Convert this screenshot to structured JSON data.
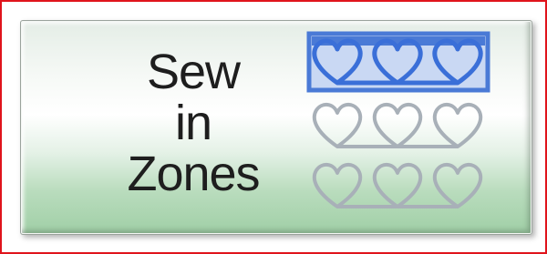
{
  "button": {
    "label_lines": [
      "Sew",
      "in",
      "Zones"
    ]
  },
  "icon": {
    "name": "heart-zones-icon",
    "rows": 3,
    "hearts_per_row": 3,
    "selected_row": 1
  },
  "colors": {
    "frame_border": "#e0141c",
    "selected_heart": "#3a6fd8",
    "selected_zone_border": "#4a7ad6",
    "selected_zone_fill": "#c9d8f3",
    "inactive_heart": "#a8b0b8",
    "text": "#1e1e1e"
  }
}
